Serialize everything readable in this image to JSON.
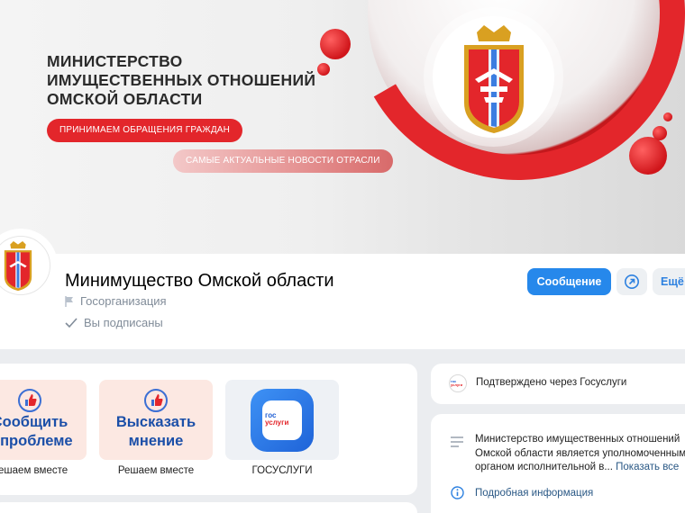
{
  "cover": {
    "title_lines": [
      "МИНИСТЕРСТВО",
      "ИМУЩЕСТВЕННЫХ ОТНОШЕНИЙ",
      "ОМСКОЙ ОБЛАСТИ"
    ],
    "pill_primary": "ПРИНИМАЕМ ОБРАЩЕНИЯ ГРАЖДАН",
    "pill_secondary": "САМЫЕ АКТУАЛЬНЫЕ НОВОСТИ ОТРАСЛИ"
  },
  "profile": {
    "name": "Минимущество Омской области",
    "category": "Госорганизация",
    "subscription": "Вы подписаны",
    "message_button": "Сообщение",
    "more_button": "Ещё"
  },
  "tiles": [
    {
      "title_line1": "Сообщить",
      "title_line2": "о проблеме",
      "caption": "Решаем вместе"
    },
    {
      "title_line1": "Высказать",
      "title_line2": "мнение",
      "caption": "Решаем вместе"
    },
    {
      "caption": "ГОСУСЛУГИ",
      "badge_line1": "гос",
      "badge_line2": "услуги"
    }
  ],
  "verify": {
    "text": "Подтверждено через Госуслуги"
  },
  "about": {
    "description": "Министерство имущественных отношений Омской области является уполномоченным органом исполнительной в...",
    "show_all": "Показать все",
    "details_link": "Подробная информация"
  },
  "colors": {
    "accent_red": "#e3262b",
    "primary_blue": "#2688eb",
    "link_blue": "#2a5885"
  }
}
